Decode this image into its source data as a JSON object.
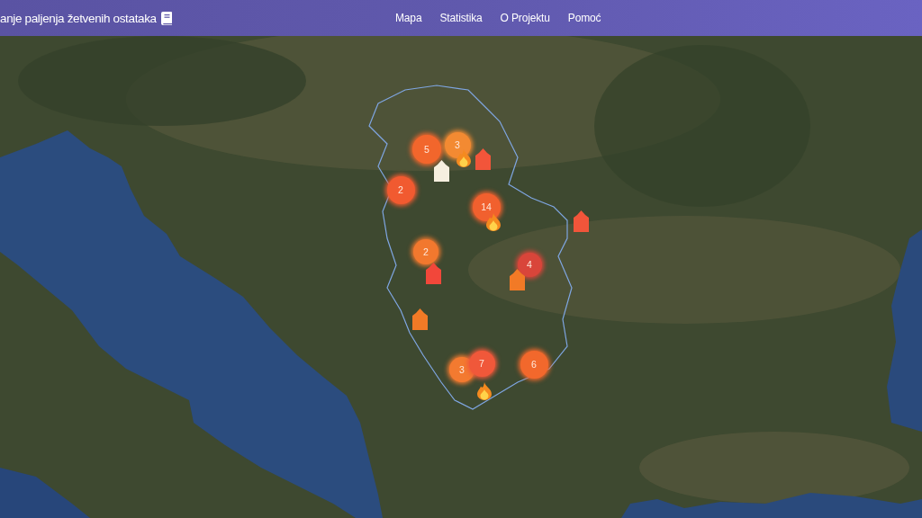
{
  "header": {
    "title": "anje paljenja žetvenih ostataka",
    "nav": [
      "Mapa",
      "Statistika",
      "O Projektu",
      "Pomoć"
    ]
  },
  "map": {
    "clusters": [
      {
        "count": "5",
        "color": "#f2662c"
      },
      {
        "count": "3",
        "color": "#f38a32"
      },
      {
        "count": "2",
        "color": "#f15a30"
      },
      {
        "count": "14",
        "color": "#f1602e"
      },
      {
        "count": "2",
        "color": "#f2782e"
      },
      {
        "count": "4",
        "color": "#d9453a"
      },
      {
        "count": "3",
        "color": "#f37a30"
      },
      {
        "count": "7",
        "color": "#f0583a"
      },
      {
        "count": "6",
        "color": "#f2682c"
      }
    ],
    "markers": [
      {
        "kind": "fire"
      },
      {
        "kind": "house",
        "color": "#f2553a"
      },
      {
        "kind": "house",
        "color": "#f6efdf"
      },
      {
        "kind": "fire"
      },
      {
        "kind": "house",
        "color": "#f2553a"
      },
      {
        "kind": "house",
        "color": "#f2473a"
      },
      {
        "kind": "house",
        "color": "#f27a26"
      },
      {
        "kind": "house",
        "color": "#f27a26"
      },
      {
        "kind": "fire"
      }
    ]
  }
}
